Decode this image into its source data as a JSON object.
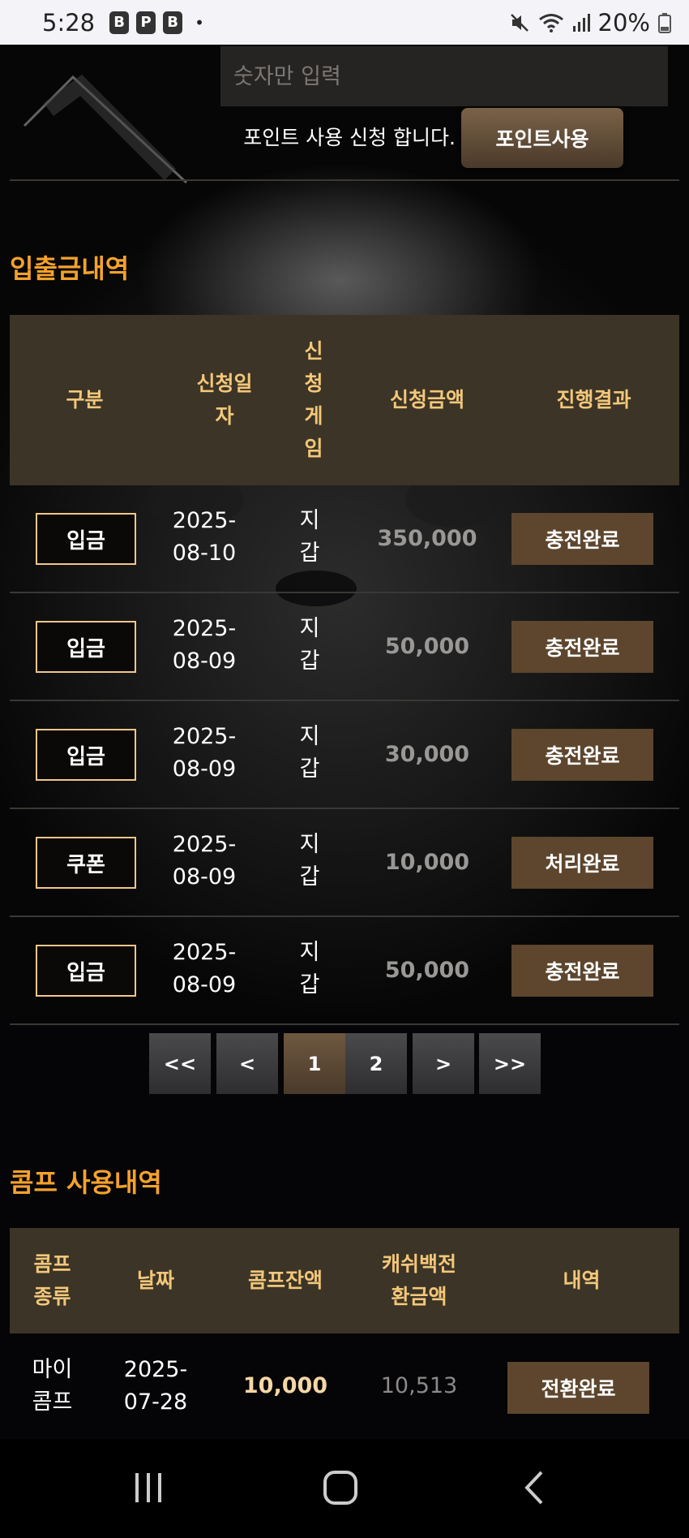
{
  "status_bar": {
    "time": "5:28",
    "app_icons": [
      "B",
      "P",
      "B"
    ],
    "dot": "•",
    "battery": "20%",
    "icons": [
      "mute-icon",
      "wifi-icon",
      "signal-icon",
      "battery-icon"
    ]
  },
  "point": {
    "input_placeholder": "숫자만 입력",
    "input_value": "",
    "message": "포인트 사용 신청 합니다.",
    "button_label": "포인트사용"
  },
  "deposit_history": {
    "title": "입출금내역",
    "headers": {
      "type": "구분",
      "date": "신청일\n자",
      "game": "신\n청\n게\n임",
      "amount": "신청금액",
      "result": "진행결과"
    },
    "rows": [
      {
        "type": "입금",
        "date": "2025-\n08-10",
        "game": "지\n갑",
        "amount": "350,000",
        "result": "충전완료"
      },
      {
        "type": "입금",
        "date": "2025-\n08-09",
        "game": "지\n갑",
        "amount": "50,000",
        "result": "충전완료"
      },
      {
        "type": "입금",
        "date": "2025-\n08-09",
        "game": "지\n갑",
        "amount": "30,000",
        "result": "충전완료"
      },
      {
        "type": "쿠폰",
        "date": "2025-\n08-09",
        "game": "지\n갑",
        "amount": "10,000",
        "result": "처리완료"
      },
      {
        "type": "입금",
        "date": "2025-\n08-09",
        "game": "지\n갑",
        "amount": "50,000",
        "result": "충전완료"
      }
    ]
  },
  "pagination": {
    "first": "<<",
    "prev": "<",
    "pages": [
      "1",
      "2"
    ],
    "current": "1",
    "next": ">",
    "last": ">>"
  },
  "comp_history": {
    "title": "콤프 사용내역",
    "headers": {
      "kind": "콤프\n종류",
      "date": "날짜",
      "balance": "콤프잔액",
      "cashback": "캐쉬백전\n환금액",
      "detail": "내역"
    },
    "rows": [
      {
        "kind": "마이\n콤프",
        "date": "2025-\n07-28",
        "balance": "10,000",
        "cashback": "10,513",
        "detail": "전환완료"
      }
    ]
  },
  "colors": {
    "accent_orange": "#f5a22b",
    "header_gold": "#f2c77a",
    "table_header_bg": "#3c3426",
    "status_button_bg": "#5d462d"
  }
}
